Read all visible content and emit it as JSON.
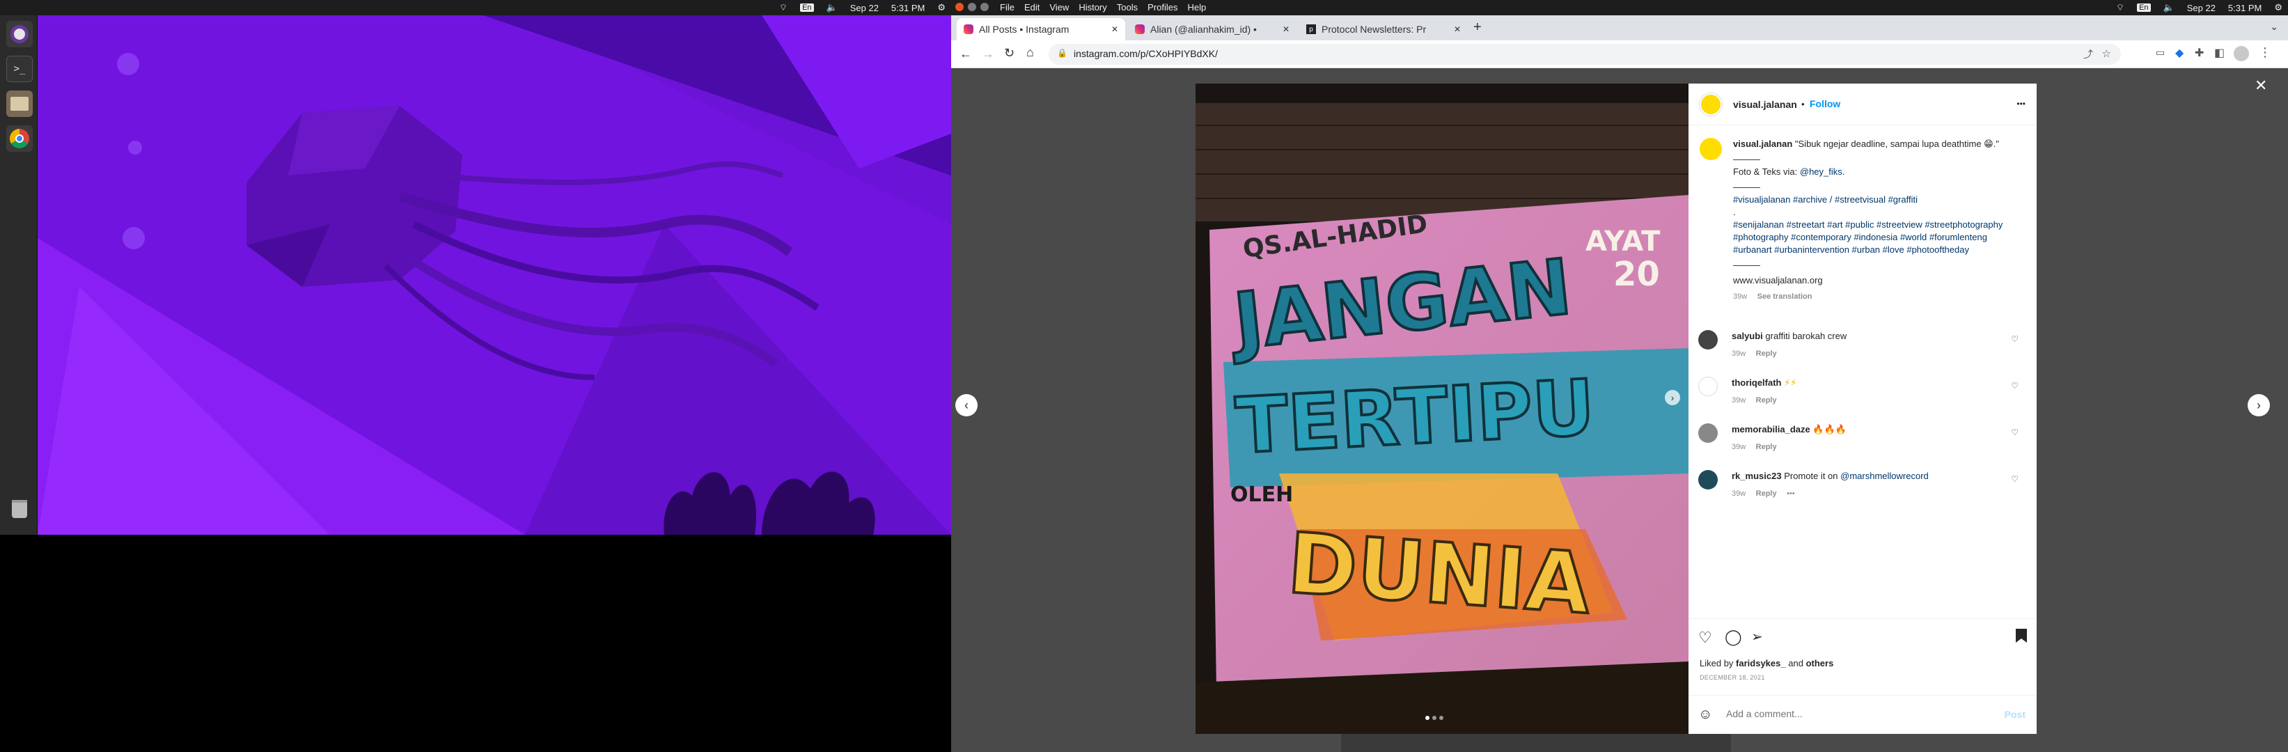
{
  "left_topbar": {
    "date": "Sep 22",
    "time": "5:31 PM",
    "lang": "En"
  },
  "right_topbar": {
    "menus": [
      "File",
      "Edit",
      "View",
      "History",
      "Tools",
      "Profiles",
      "Help"
    ],
    "date": "Sep 22",
    "time": "5:31 PM",
    "lang": "En"
  },
  "browser": {
    "tabs": [
      {
        "title": "All Posts • Instagram",
        "active": true
      },
      {
        "title": "Alian (@alianhakim_id) •",
        "active": false
      },
      {
        "title": "Protocol Newsletters: Pr",
        "active": false
      }
    ],
    "new_tab": "+",
    "url": "instagram.com/p/CXoHPIYBdXK/"
  },
  "post": {
    "username": "visual.jalanan",
    "follow_label": "Follow",
    "more": "•••",
    "caption_user": "visual.jalanan",
    "caption_text": "\"Sibuk ngejar deadline, sampai lupa deathtime 😁.\"",
    "sep1": "———",
    "credit_prefix": "Foto & Teks via:",
    "credit_handle": "@hey_fiks.",
    "sep2": "———",
    "tags1": "#visualjalanan #archive / #streetvisual #graffiti",
    "dot": ".",
    "tags2": "#senijalanan #streetart #art #public #streetview #streetphotography #photography #contemporary #indonesia #world #forumlenteng #urbanart #urbanintervention #urban #love #photooftheday",
    "sep3": "———",
    "website": "www.visualjalanan.org",
    "caption_age": "39w",
    "see_translation": "See translation",
    "comments": [
      {
        "user": "salyubi",
        "text": "graffiti barokah crew",
        "age": "39w",
        "reply": "Reply"
      },
      {
        "user": "thoriqelfath",
        "text": "⚡⚡",
        "age": "39w",
        "reply": "Reply"
      },
      {
        "user": "memorabilia_daze",
        "text": "🔥🔥🔥",
        "age": "39w",
        "reply": "Reply"
      },
      {
        "user": "rk_music23",
        "text": "Promote it on",
        "mention": "@marshmellowrecord",
        "age": "39w",
        "reply": "Reply",
        "more": "•••"
      }
    ],
    "liked_by_prefix": "Liked by",
    "liked_by_user": "faridsykes_",
    "liked_by_and": "and",
    "liked_by_others": "others",
    "date": "DECEMBER 18, 2021",
    "add_comment_placeholder": "Add a comment...",
    "post_button": "Post",
    "close": "✕"
  },
  "graffiti": {
    "line1": "QS.AL-HADID",
    "line2": "JANGAN",
    "line3": "TERTIPU",
    "line4": "OLEH",
    "line5": "DUNIA",
    "side1": "AYAT",
    "side2": "20"
  },
  "colors": {
    "wallpaper": "#6c11d6",
    "ig_blue": "#0095f6",
    "link": "#00376b"
  }
}
